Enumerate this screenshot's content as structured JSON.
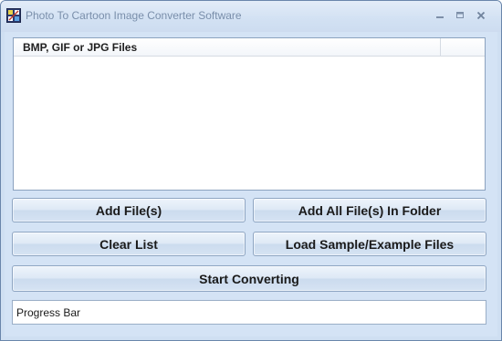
{
  "window": {
    "title": "Photo To Cartoon Image Converter Software",
    "controls": {
      "minimize_icon": "minimize-icon",
      "maximize_icon": "maximize-icon",
      "close_icon": "close-icon"
    }
  },
  "file_list": {
    "column_header": "BMP, GIF or JPG Files",
    "items": []
  },
  "buttons": {
    "add_files": "Add File(s)",
    "add_folder": "Add All File(s) In Folder",
    "clear_list": "Clear List",
    "load_samples": "Load Sample/Example Files",
    "start_converting": "Start Converting"
  },
  "progress": {
    "label": "Progress Bar"
  },
  "colors": {
    "window_background": "#d4e3f5",
    "title_text": "#7a8fab",
    "button_border": "#8fa6c3"
  }
}
